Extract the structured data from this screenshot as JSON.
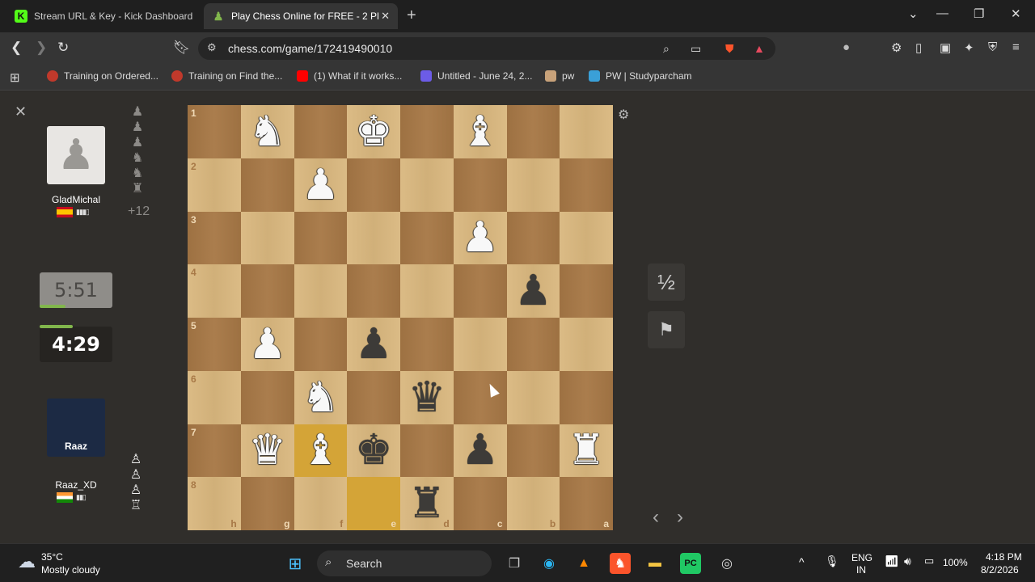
{
  "browser": {
    "tabs": [
      {
        "title": "Stream URL & Key - Kick Dashboard",
        "favicon": "K"
      },
      {
        "title": "Play Chess Online for FREE - 2 Pl",
        "favicon": "♟"
      }
    ],
    "url": "chess.com/game/172419490010",
    "bookmarks": [
      "Training on Ordered...",
      "Training on Find the...",
      "(1) What if it works...",
      "Untitled - June 24, 2...",
      "pw",
      "PW | Studyparcham"
    ]
  },
  "game": {
    "opponent": {
      "name": "GladMichal",
      "clock": "5:51",
      "captured": [
        "♟",
        "♟",
        "♟",
        "♞",
        "♞",
        "♜"
      ],
      "material_advantage": "+12",
      "clock_level": 0.35
    },
    "player": {
      "name": "Raaz_XD",
      "clock": "4:29",
      "avatar_text": "Raaz",
      "captured": [
        "♙",
        "♙",
        "♙",
        "♖"
      ],
      "clock_level": 0.45
    },
    "draw_label": "½",
    "rank_labels": [
      "1",
      "2",
      "3",
      "4",
      "5",
      "6",
      "7",
      "8"
    ],
    "file_labels": [
      "h",
      "g",
      "f",
      "e",
      "d",
      "c",
      "b",
      "a"
    ],
    "board": [
      [
        "",
        "wN",
        "",
        "wK",
        "",
        "wB",
        "",
        ""
      ],
      [
        "",
        "",
        "wP",
        "",
        "",
        "",
        "",
        ""
      ],
      [
        "",
        "",
        "",
        "",
        "",
        "wP",
        "",
        ""
      ],
      [
        "",
        "",
        "",
        "",
        "",
        "",
        "bP",
        ""
      ],
      [
        "",
        "wP",
        "",
        "bP",
        "",
        "",
        "",
        ""
      ],
      [
        "",
        "",
        "wN",
        "",
        "bQ",
        "",
        "",
        ""
      ],
      [
        "",
        "wQ",
        "wB",
        "bK",
        "",
        "bP",
        "",
        "wR"
      ],
      [
        "",
        "",
        "",
        "",
        "bR",
        "",
        "",
        ""
      ]
    ],
    "highlighted_squares": [
      [
        6,
        2
      ],
      [
        7,
        3
      ]
    ]
  },
  "taskbar": {
    "weather_temp": "35°C",
    "weather_desc": "Mostly cloudy",
    "search_label": "Search",
    "lang_top": "ENG",
    "lang_bottom": "IN",
    "battery": "100%",
    "time": "4:18 PM",
    "date": "8/2/2026"
  }
}
